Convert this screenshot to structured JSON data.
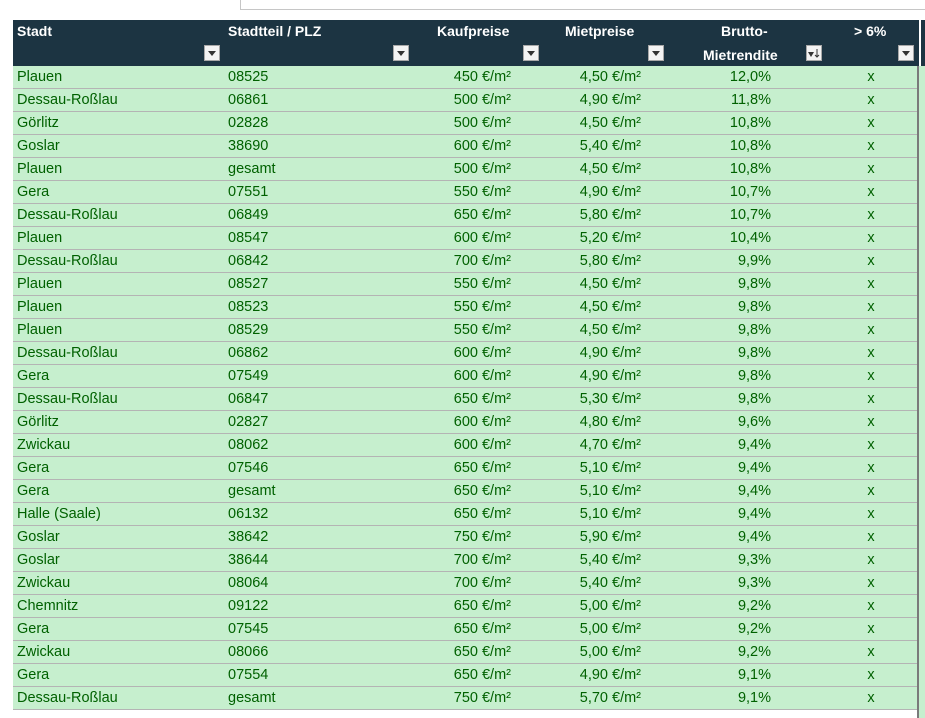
{
  "headers": {
    "stadt": "Stadt",
    "plz": "Stadtteil / PLZ",
    "kauf": "Kaufpreise",
    "miete": "Mietpreise",
    "rend_line1": "Brutto-",
    "rend_line2": "Mietrendite",
    "gt": "> 6%"
  },
  "icons": {
    "filter": "filter-dropdown-icon",
    "sort": "sort-descending-icon"
  },
  "colors": {
    "header_bg": "#1c3442",
    "row_bg": "#c6efce",
    "row_text": "#006100"
  },
  "rows": [
    {
      "stadt": "Plauen",
      "plz": "08525",
      "kauf": "450 €/m²",
      "miete": "4,50 €/m²",
      "rend": "12,0%",
      "gt": "x"
    },
    {
      "stadt": "Dessau-Roßlau",
      "plz": "06861",
      "kauf": "500 €/m²",
      "miete": "4,90 €/m²",
      "rend": "11,8%",
      "gt": "x"
    },
    {
      "stadt": "Görlitz",
      "plz": "02828",
      "kauf": "500 €/m²",
      "miete": "4,50 €/m²",
      "rend": "10,8%",
      "gt": "x"
    },
    {
      "stadt": "Goslar",
      "plz": "38690",
      "kauf": "600 €/m²",
      "miete": "5,40 €/m²",
      "rend": "10,8%",
      "gt": "x"
    },
    {
      "stadt": "Plauen",
      "plz": "gesamt",
      "kauf": "500 €/m²",
      "miete": "4,50 €/m²",
      "rend": "10,8%",
      "gt": "x"
    },
    {
      "stadt": "Gera",
      "plz": "07551",
      "kauf": "550 €/m²",
      "miete": "4,90 €/m²",
      "rend": "10,7%",
      "gt": "x"
    },
    {
      "stadt": "Dessau-Roßlau",
      "plz": "06849",
      "kauf": "650 €/m²",
      "miete": "5,80 €/m²",
      "rend": "10,7%",
      "gt": "x"
    },
    {
      "stadt": "Plauen",
      "plz": "08547",
      "kauf": "600 €/m²",
      "miete": "5,20 €/m²",
      "rend": "10,4%",
      "gt": "x"
    },
    {
      "stadt": "Dessau-Roßlau",
      "plz": "06842",
      "kauf": "700 €/m²",
      "miete": "5,80 €/m²",
      "rend": "9,9%",
      "gt": "x"
    },
    {
      "stadt": "Plauen",
      "plz": "08527",
      "kauf": "550 €/m²",
      "miete": "4,50 €/m²",
      "rend": "9,8%",
      "gt": "x"
    },
    {
      "stadt": "Plauen",
      "plz": "08523",
      "kauf": "550 €/m²",
      "miete": "4,50 €/m²",
      "rend": "9,8%",
      "gt": "x"
    },
    {
      "stadt": "Plauen",
      "plz": "08529",
      "kauf": "550 €/m²",
      "miete": "4,50 €/m²",
      "rend": "9,8%",
      "gt": "x"
    },
    {
      "stadt": "Dessau-Roßlau",
      "plz": "06862",
      "kauf": "600 €/m²",
      "miete": "4,90 €/m²",
      "rend": "9,8%",
      "gt": "x"
    },
    {
      "stadt": "Gera",
      "plz": "07549",
      "kauf": "600 €/m²",
      "miete": "4,90 €/m²",
      "rend": "9,8%",
      "gt": "x"
    },
    {
      "stadt": "Dessau-Roßlau",
      "plz": "06847",
      "kauf": "650 €/m²",
      "miete": "5,30 €/m²",
      "rend": "9,8%",
      "gt": "x"
    },
    {
      "stadt": "Görlitz",
      "plz": "02827",
      "kauf": "600 €/m²",
      "miete": "4,80 €/m²",
      "rend": "9,6%",
      "gt": "x"
    },
    {
      "stadt": "Zwickau",
      "plz": "08062",
      "kauf": "600 €/m²",
      "miete": "4,70 €/m²",
      "rend": "9,4%",
      "gt": "x"
    },
    {
      "stadt": "Gera",
      "plz": "07546",
      "kauf": "650 €/m²",
      "miete": "5,10 €/m²",
      "rend": "9,4%",
      "gt": "x"
    },
    {
      "stadt": "Gera",
      "plz": "gesamt",
      "kauf": "650 €/m²",
      "miete": "5,10 €/m²",
      "rend": "9,4%",
      "gt": "x"
    },
    {
      "stadt": "Halle (Saale)",
      "plz": "06132",
      "kauf": "650 €/m²",
      "miete": "5,10 €/m²",
      "rend": "9,4%",
      "gt": "x"
    },
    {
      "stadt": "Goslar",
      "plz": "38642",
      "kauf": "750 €/m²",
      "miete": "5,90 €/m²",
      "rend": "9,4%",
      "gt": "x"
    },
    {
      "stadt": "Goslar",
      "plz": "38644",
      "kauf": "700 €/m²",
      "miete": "5,40 €/m²",
      "rend": "9,3%",
      "gt": "x"
    },
    {
      "stadt": "Zwickau",
      "plz": "08064",
      "kauf": "700 €/m²",
      "miete": "5,40 €/m²",
      "rend": "9,3%",
      "gt": "x"
    },
    {
      "stadt": "Chemnitz",
      "plz": "09122",
      "kauf": "650 €/m²",
      "miete": "5,00 €/m²",
      "rend": "9,2%",
      "gt": "x"
    },
    {
      "stadt": "Gera",
      "plz": "07545",
      "kauf": "650 €/m²",
      "miete": "5,00 €/m²",
      "rend": "9,2%",
      "gt": "x"
    },
    {
      "stadt": "Zwickau",
      "plz": "08066",
      "kauf": "650 €/m²",
      "miete": "5,00 €/m²",
      "rend": "9,2%",
      "gt": "x"
    },
    {
      "stadt": "Gera",
      "plz": "07554",
      "kauf": "650 €/m²",
      "miete": "4,90 €/m²",
      "rend": "9,1%",
      "gt": "x"
    },
    {
      "stadt": "Dessau-Roßlau",
      "plz": "gesamt",
      "kauf": "750 €/m²",
      "miete": "5,70 €/m²",
      "rend": "9,1%",
      "gt": "x"
    }
  ]
}
